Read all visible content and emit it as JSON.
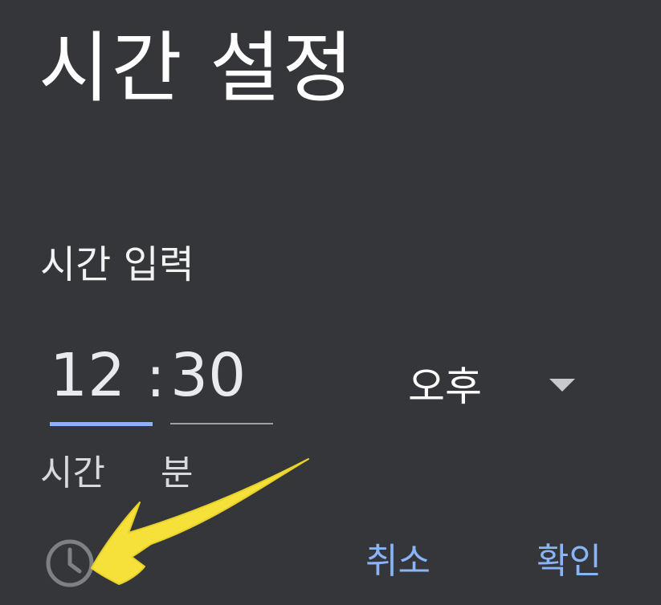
{
  "dialog": {
    "title": "시간 설정",
    "subtitle": "시간 입력"
  },
  "time": {
    "hour": "12",
    "separator": ":",
    "minute": "30",
    "period": "오후",
    "hour_label": "시간",
    "minute_label": "분"
  },
  "actions": {
    "cancel_label": "취소",
    "ok_label": "확인"
  },
  "icons": {
    "clock_toggle": "clock-icon",
    "period_dropdown": "caret-down-icon",
    "annotation": "arrow-icon"
  },
  "colors": {
    "background": "#35363a",
    "accent": "#8ab4f8",
    "annotation_arrow": "#f5e13a"
  }
}
